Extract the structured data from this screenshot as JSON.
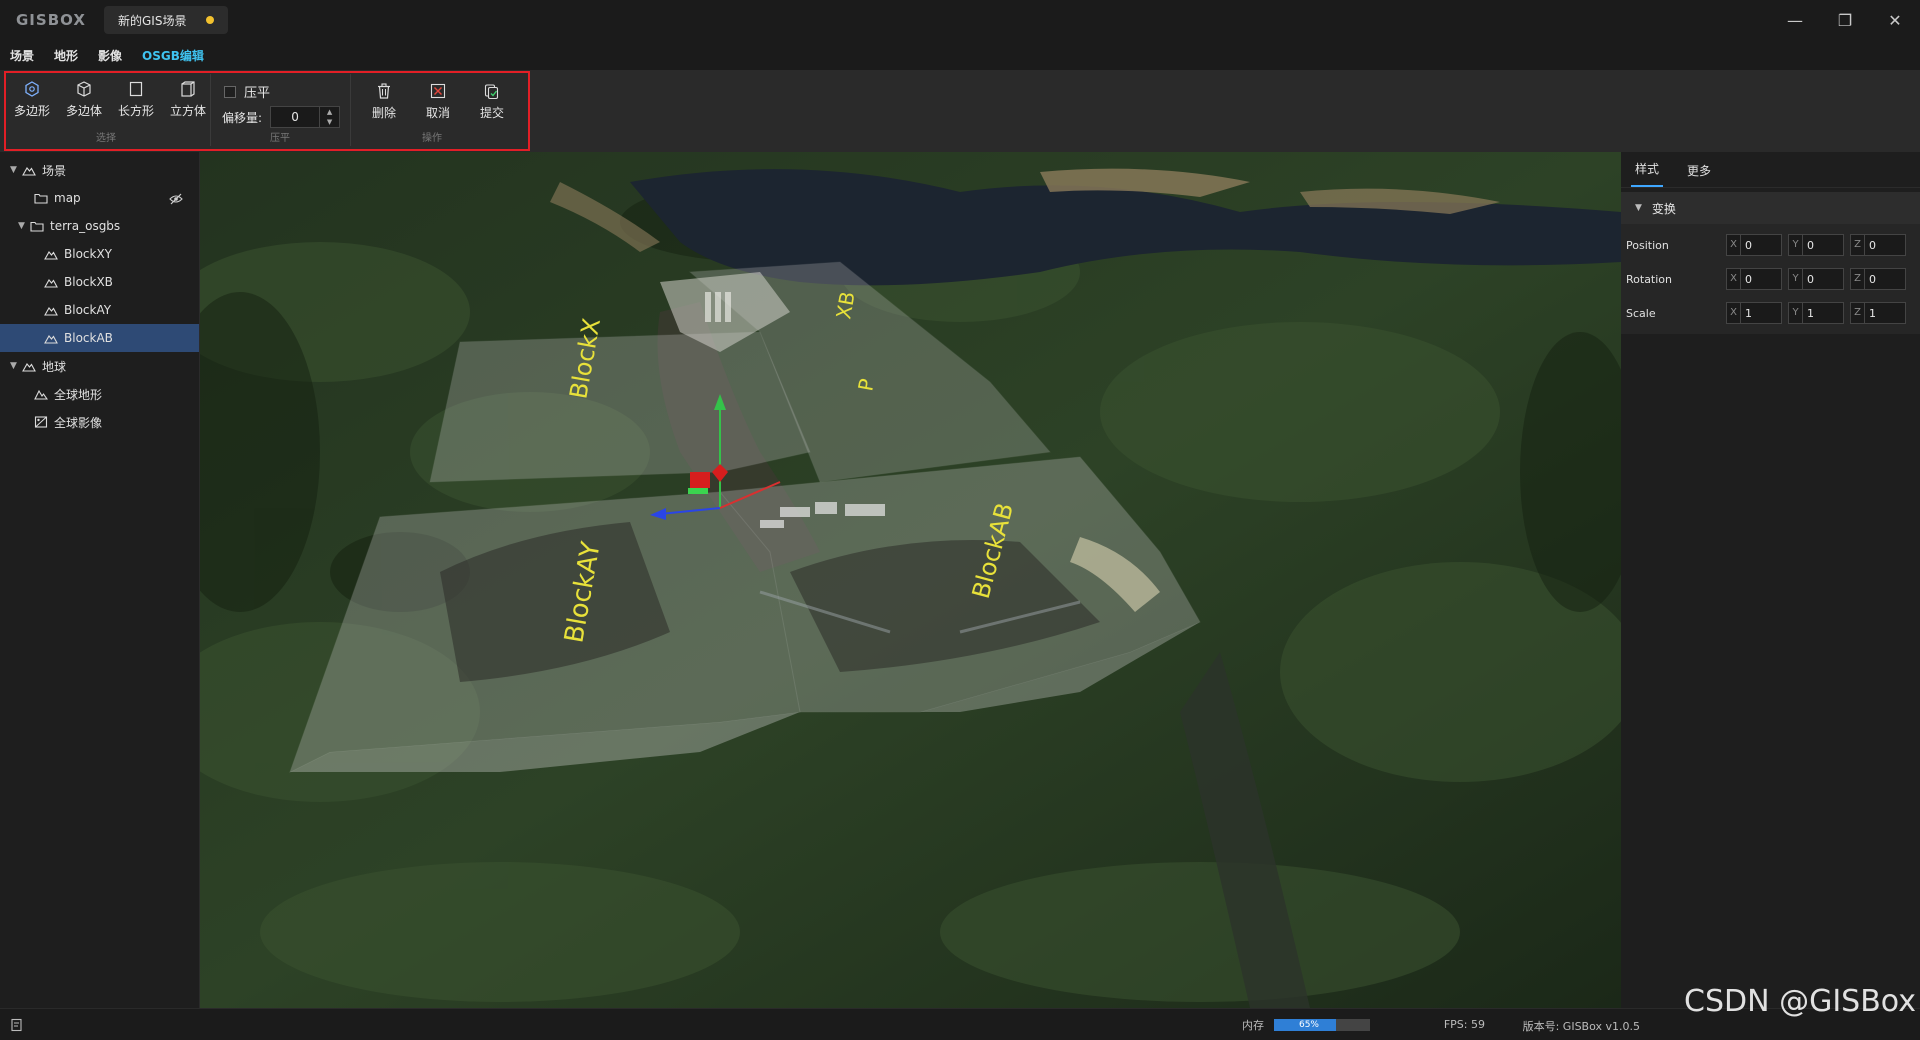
{
  "app": {
    "logo": "GISBOX",
    "doc_tab": "新的GIS场景"
  },
  "window_controls": {
    "minimize": "—",
    "restore": "❐",
    "close": "✕"
  },
  "menu": [
    {
      "label": "场景"
    },
    {
      "label": "地形"
    },
    {
      "label": "影像"
    },
    {
      "label": "OSGB编辑",
      "active": true
    }
  ],
  "ribbon": {
    "select": {
      "label": "选择",
      "tools": [
        {
          "label": "多边形",
          "icon": "polygon-icon"
        },
        {
          "label": "多边体",
          "icon": "polyhedron-icon"
        },
        {
          "label": "长方形",
          "icon": "rectangle-icon"
        },
        {
          "label": "立方体",
          "icon": "cube-icon"
        }
      ]
    },
    "flatten": {
      "label": "压平",
      "checkbox_label": "压平",
      "checked": false,
      "offset_label": "偏移量:",
      "offset_value": "0"
    },
    "ops": {
      "label": "操作",
      "tools": [
        {
          "label": "删除",
          "icon": "trash-icon"
        },
        {
          "label": "取消",
          "icon": "cancel-icon"
        },
        {
          "label": "提交",
          "icon": "submit-icon"
        }
      ]
    },
    "highlight_color": "#e21f26"
  },
  "tree": {
    "scene_label": "场景",
    "map_label": "map",
    "terra_label": "terra_osgbs",
    "blocks": [
      "BlockXY",
      "BlockXB",
      "BlockAY",
      "BlockAB"
    ],
    "selected_block": "BlockAB",
    "earth_label": "地球",
    "global_terrain": "全球地形",
    "global_imagery": "全球影像"
  },
  "viewport": {
    "labels": {
      "block_x": "BlockX",
      "block_xb": "XB",
      "block_xb_frag": "P",
      "block_ay": "BlockAY",
      "block_ab": "BlockAB"
    },
    "label_color": "#e8e13a"
  },
  "right_panel": {
    "tabs": [
      "样式",
      "更多"
    ],
    "section": "变换",
    "position": {
      "label": "Position",
      "x": "0",
      "y": "0",
      "z": "0"
    },
    "rotation": {
      "label": "Rotation",
      "x": "0",
      "y": "0",
      "z": "0"
    },
    "scale": {
      "label": "Scale",
      "x": "1",
      "y": "1",
      "z": "1"
    },
    "axes": {
      "x": "X",
      "y": "Y",
      "z": "Z"
    }
  },
  "status": {
    "memory_label": "内存",
    "memory_percent": 65,
    "memory_text": "65%",
    "fps": "FPS: 59",
    "version": "版本号: GISBox v1.0.5"
  },
  "watermark": "CSDN @GISBox"
}
